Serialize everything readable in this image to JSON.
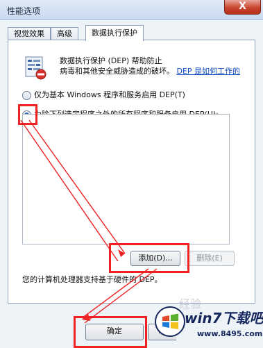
{
  "window": {
    "title": "性能选项",
    "close_label": "X"
  },
  "tabs": [
    {
      "label": "视觉效果"
    },
    {
      "label": "高级"
    },
    {
      "label": "数据执行保护",
      "active": true
    }
  ],
  "dep": {
    "icon": "dep-shield-icon",
    "description": "数据执行保护 (DEP) 帮助防止病毒和其他安全威胁造成的破坏。",
    "desc_part1": "数据执行保护 (DEP) 帮助防止",
    "desc_part2": "病毒和其他安全威胁造成的破坏。",
    "link": "DEP 是如何工作的",
    "option_basic": "仅为基本 Windows 程序和服务启用 DEP(T)",
    "option_all_except": "为除下列选定程序之外的所有程序和服务启用 DEP(U):",
    "selected_option": "all_except",
    "add_button": "添加(D)...",
    "remove_button": "删除(E)",
    "hardware_note": "您的计算机处理器支持基于硬件的 DEP。"
  },
  "footer": {
    "ok_button": "确定",
    "cancel_button": "取"
  },
  "watermark": {
    "title": "win7下载吧",
    "url": "www.8495.com",
    "logo_icon": "win7-logo-icon",
    "faint_text": "经验"
  },
  "annotation_color": "#ee2222"
}
